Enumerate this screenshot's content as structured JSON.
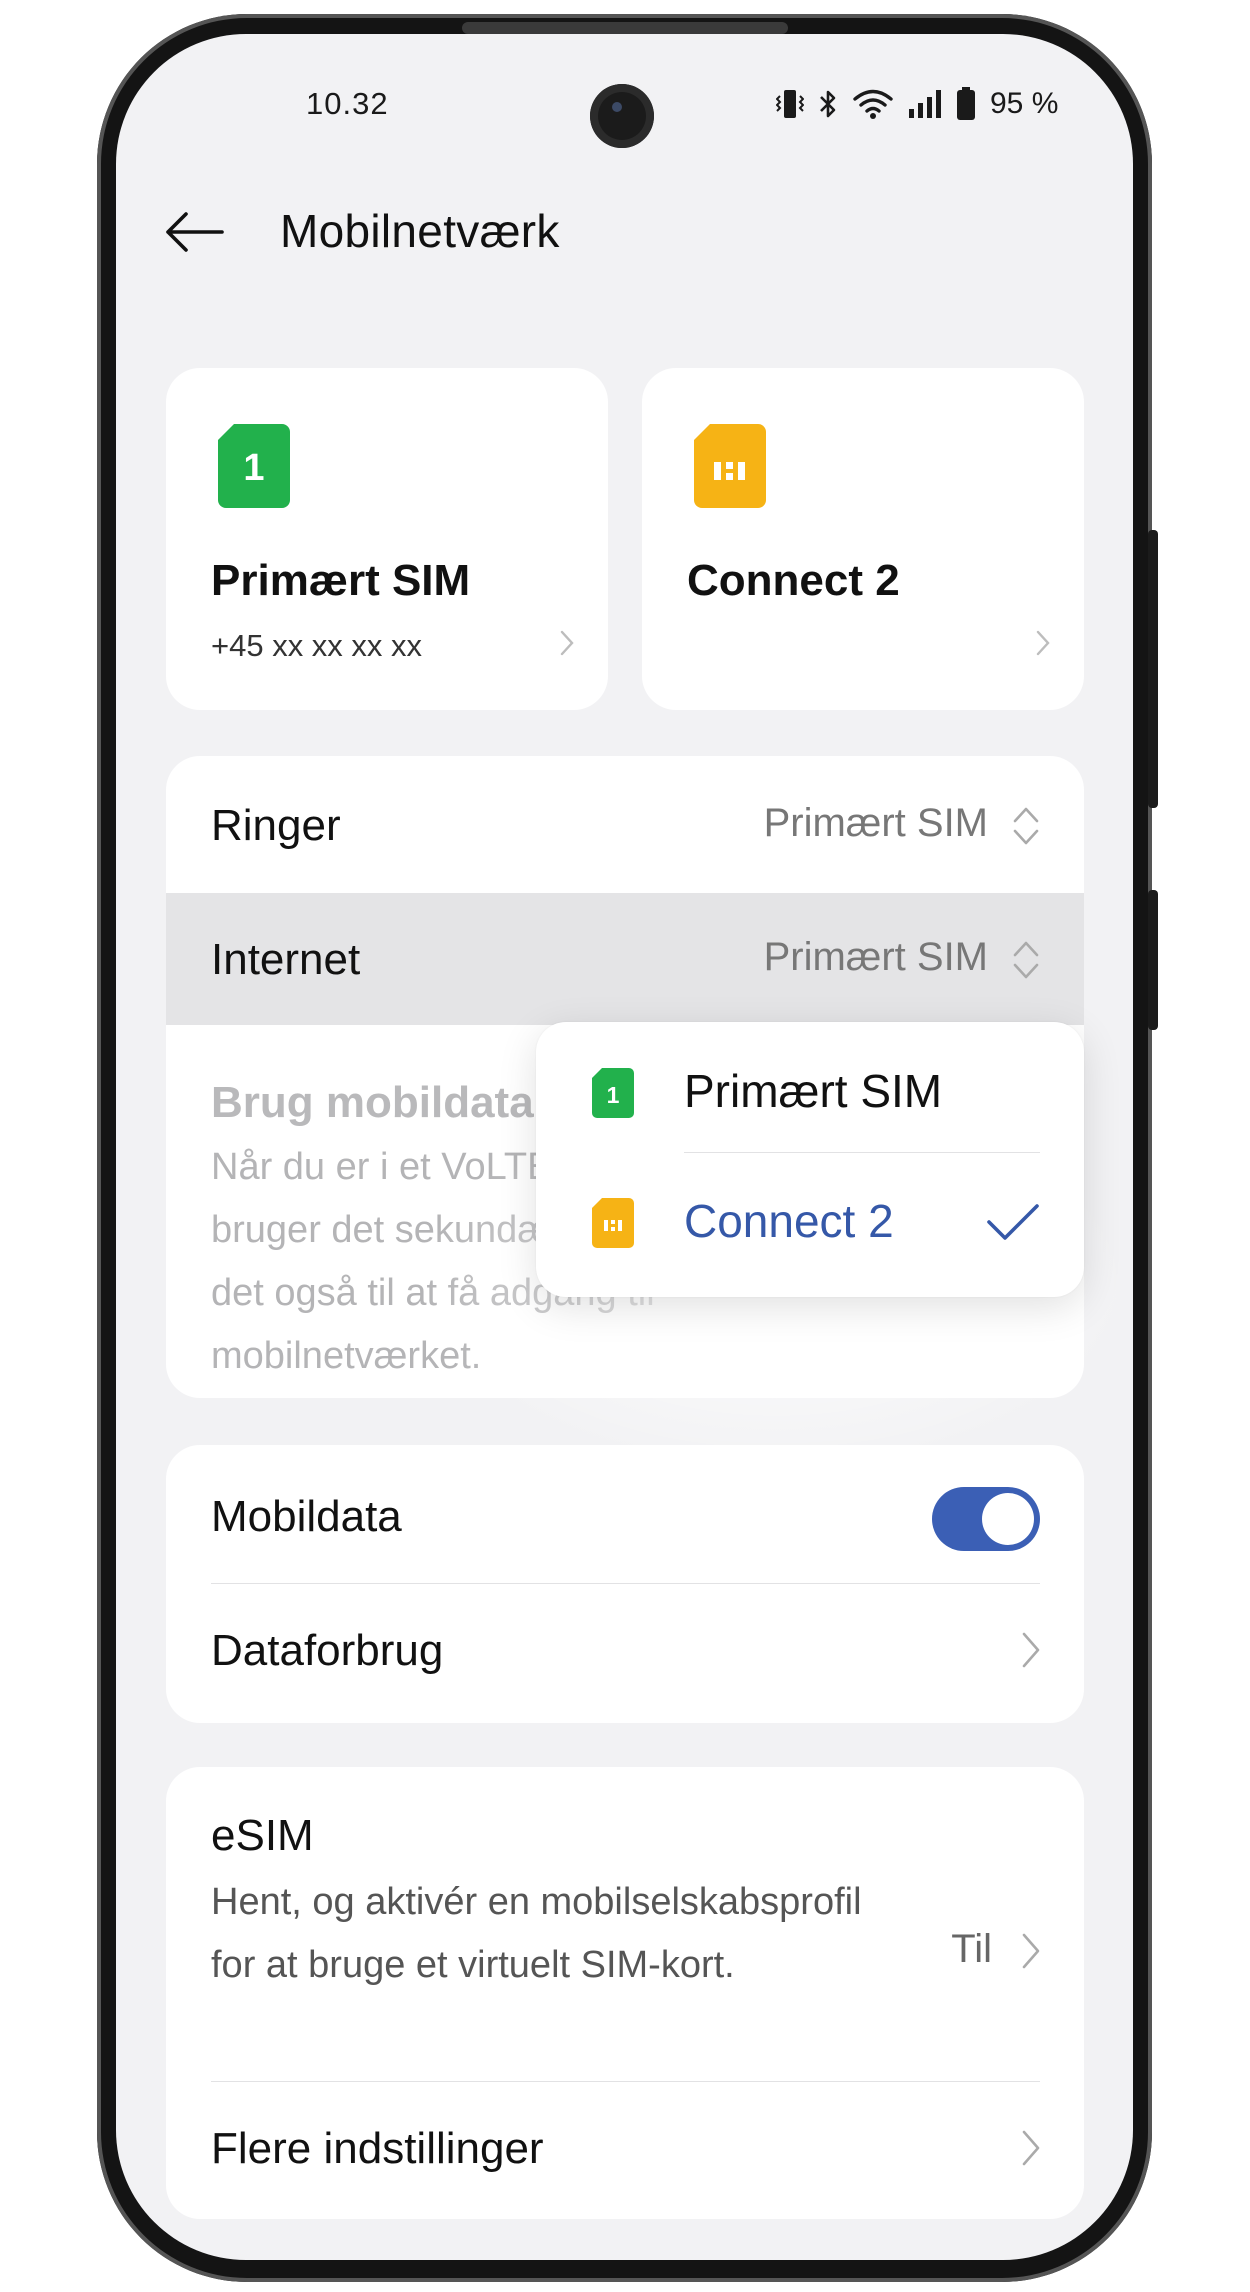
{
  "status_bar": {
    "time": "10.32",
    "battery": "95 %",
    "icons": [
      "vibrate-icon",
      "bluetooth-icon",
      "wifi-icon",
      "signal-icon",
      "battery-icon"
    ]
  },
  "header": {
    "title": "Mobilnetværk",
    "back_icon": "back-arrow-icon"
  },
  "sim_cards": [
    {
      "name": "Primært SIM",
      "number": "+45 xx xx xx xx",
      "badge": "1",
      "color": "#22b14c"
    },
    {
      "name": "Connect 2",
      "number": "",
      "color": "#f6b315"
    }
  ],
  "preferences": {
    "ringer_label": "Ringer",
    "ringer_value": "Primært SIM",
    "internet_label": "Internet",
    "internet_value": "Primært SIM",
    "secondary_title": "Brug mobildata",
    "secondary_desc": "Når du er i et VoLTE-opkald, og du bruger det sekundære SIM-kort, brug det også til at få adgang til mobilnetværket."
  },
  "dropdown": {
    "options": [
      {
        "label": "Primært SIM",
        "badge": "1",
        "selected": false
      },
      {
        "label": "Connect 2",
        "selected": true
      }
    ]
  },
  "data": {
    "mobildata_label": "Mobildata",
    "mobildata_on": true,
    "dataforbrug_label": "Dataforbrug"
  },
  "esim": {
    "title": "eSIM",
    "desc": "Hent, og aktivér en mobilselskabsprofil for at bruge et virtuelt SIM-kort.",
    "value": "Til",
    "more_label": "Flere indstillinger"
  },
  "colors": {
    "accent": "#3b5fb5",
    "selected_text": "#3558a8",
    "sim1": "#22b14c",
    "sim2": "#f6b315",
    "background": "#f2f2f4"
  }
}
